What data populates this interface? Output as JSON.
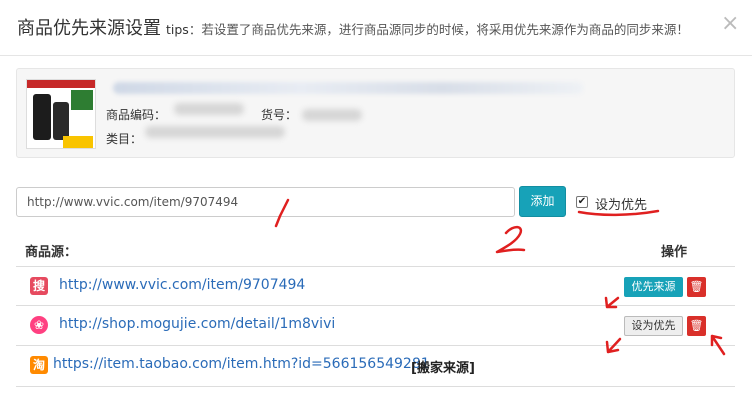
{
  "header": {
    "title": "商品优先来源设置",
    "tips_label": "tips",
    "tips_text": "：若设置了商品优先来源，进行商品源同步的时候，将采用优先来源作为商品的同步来源！",
    "close_icon": "×"
  },
  "product": {
    "code_label": "商品编码：",
    "item_no_label": "货号：",
    "category_label": "类目："
  },
  "form": {
    "url_value": "http://www.vvic.com/item/9707494",
    "add_label": "添加",
    "priority_label": "设为优先",
    "priority_checked": true,
    "check_glyph": "✔"
  },
  "table": {
    "col_source": "商品源：",
    "col_ops": "操作",
    "rows": [
      {
        "icon_glyph": "搜",
        "icon_color": "#e64a5f",
        "url": "http://www.vvic.com/item/9707494",
        "action": "优先来源",
        "delete_glyph": "🗑"
      },
      {
        "icon_glyph": "❀",
        "icon_color": "#ff4081",
        "url": "http://shop.mogujie.com/detail/1m8vivi",
        "action": "设为优先",
        "delete_glyph": "🗑"
      },
      {
        "icon_glyph": "淘",
        "icon_color": "#ff8a00",
        "url": "https://item.taobao.com/item.htm?id=566156549281",
        "note": "[搬家来源]"
      }
    ]
  },
  "colors": {
    "accent_teal": "#17a2b8",
    "danger": "#d9302a",
    "link": "#2a6bb8",
    "annotation": "#e02020"
  }
}
